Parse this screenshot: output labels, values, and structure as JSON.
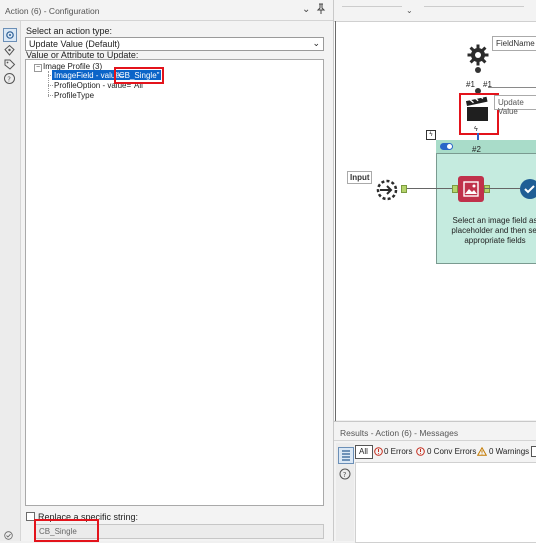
{
  "config_panel": {
    "title": "Action (6) - Configuration",
    "select_action_label": "Select an action type:",
    "action_type_value": "Update Value (Default)",
    "value_attr_label": "Value or Attribute to Update:",
    "tree": {
      "root": "Image Profile (3)",
      "expander": "−",
      "items": [
        {
          "name": "ImageField - value=",
          "value": "\"CB_Single\""
        },
        {
          "name": "ProfileOption - value=\"All\""
        },
        {
          "name": "ProfileType"
        }
      ]
    },
    "replace_label": "Replace a specific string:",
    "replace_value": "CB_Single"
  },
  "canvas": {
    "field_name_label": "FieldName",
    "update_value_label": "Update Value",
    "input_label": "Input",
    "anchor_1a": "#1",
    "anchor_1b": "#1",
    "anchor_2": "#2",
    "container_text": "Select an image field as placeholder and then sel appropriate fields"
  },
  "results": {
    "title": "Results - Action (6) - Messages",
    "all_label": "All",
    "errors": "0 Errors",
    "conv_errors": "0 Conv Errors",
    "warnings": "0 Warnings"
  },
  "colors": {
    "highlight": "#e3131b",
    "selection": "#0b64c8",
    "container": "#c5ebdf",
    "image_tool": "#c0314b"
  }
}
